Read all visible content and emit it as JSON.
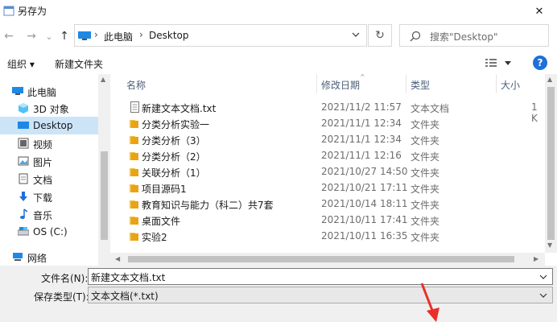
{
  "window": {
    "title": "另存为",
    "close_glyph": "✕"
  },
  "nav": {
    "back": "←",
    "forward": "→",
    "recent": "⌄",
    "up": "↑",
    "breadcrumbs": [
      "此电脑",
      "Desktop"
    ],
    "crumb_sep": "›",
    "refresh": "↻",
    "search_placeholder": "搜索\"Desktop\""
  },
  "toolbar": {
    "organize": "组织 ▾",
    "new_folder": "新建文件夹"
  },
  "sidebar": {
    "items": [
      {
        "label": "此电脑",
        "icon": "computer-icon"
      },
      {
        "label": "3D 对象",
        "icon": "3d-objects-icon"
      },
      {
        "label": "Desktop",
        "icon": "desktop-icon"
      },
      {
        "label": "视频",
        "icon": "video-icon"
      },
      {
        "label": "图片",
        "icon": "picture-icon"
      },
      {
        "label": "文档",
        "icon": "document-icon"
      },
      {
        "label": "下载",
        "icon": "download-icon"
      },
      {
        "label": "音乐",
        "icon": "music-icon"
      },
      {
        "label": "OS (C:)",
        "icon": "drive-icon"
      },
      {
        "label": "网络",
        "icon": "network-icon"
      }
    ]
  },
  "filelist": {
    "columns": {
      "name": "名称",
      "date": "修改日期",
      "type": "类型",
      "size": "大小"
    },
    "rows": [
      {
        "name": "新建文本文档.txt",
        "date": "2021/11/2 11:57",
        "type": "文本文档",
        "size": "1 K",
        "icon": "text-file-icon"
      },
      {
        "name": "分类分析实验一",
        "date": "2021/11/1 12:34",
        "type": "文件夹",
        "size": "",
        "icon": "folder-icon"
      },
      {
        "name": "分类分析（3）",
        "date": "2021/11/1 12:34",
        "type": "文件夹",
        "size": "",
        "icon": "folder-icon"
      },
      {
        "name": "分类分析（2）",
        "date": "2021/11/1 12:16",
        "type": "文件夹",
        "size": "",
        "icon": "folder-icon"
      },
      {
        "name": "关联分析（1）",
        "date": "2021/10/27 14:50",
        "type": "文件夹",
        "size": "",
        "icon": "folder-icon"
      },
      {
        "name": "项目源码1",
        "date": "2021/10/21 17:11",
        "type": "文件夹",
        "size": "",
        "icon": "folder-icon"
      },
      {
        "name": "教育知识与能力（科二）共7套",
        "date": "2021/10/14 18:11",
        "type": "文件夹",
        "size": "",
        "icon": "folder-icon"
      },
      {
        "name": "桌面文件",
        "date": "2021/10/11 17:41",
        "type": "文件夹",
        "size": "",
        "icon": "folder-icon"
      },
      {
        "name": "实验2",
        "date": "2021/10/11 16:35",
        "type": "文件夹",
        "size": "",
        "icon": "folder-icon"
      }
    ]
  },
  "form": {
    "filename_label": "文件名(N):",
    "filename_value": "新建文本文档.txt",
    "filetype_label": "保存类型(T):",
    "filetype_value": "文本文档(*.txt)"
  },
  "colors": {
    "accent": "#1e6fd9",
    "selection": "#cce4f7",
    "folder": "#f0c14b",
    "annotation_arrow": "#e8302a"
  }
}
